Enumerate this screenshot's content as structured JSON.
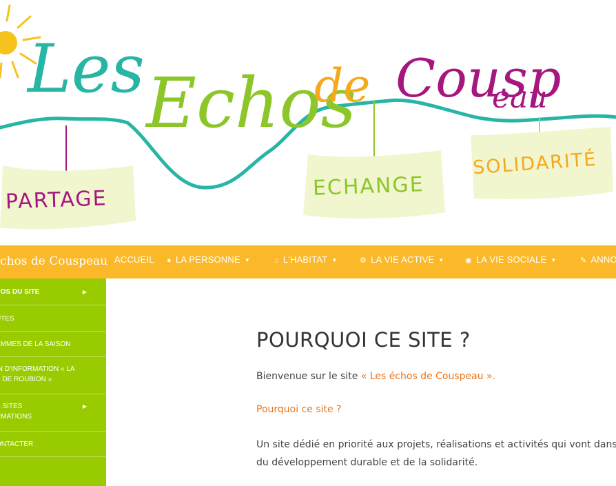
{
  "banner": {
    "title_parts": [
      "Les",
      "Echos",
      "de",
      "Cousp",
      "eau"
    ],
    "signs": [
      "PARTAGE",
      "ECHANGE",
      "SOLIDARITÉ"
    ]
  },
  "navbar": {
    "brand": "échos de Couspeau",
    "items": [
      {
        "label": "ACCUEIL",
        "icon": "",
        "has_caret": false
      },
      {
        "label": "LA PERSONNE",
        "icon": "person-icon",
        "has_caret": true
      },
      {
        "label": "L'HABITAT",
        "icon": "home-icon",
        "has_caret": true
      },
      {
        "label": "LA VIE ACTIVE",
        "icon": "gear-icon",
        "has_caret": true
      },
      {
        "label": "LA VIE SOCIALE",
        "icon": "globe-icon",
        "has_caret": true
      },
      {
        "label": "ANNO",
        "icon": "edit-icon",
        "has_caret": false
      }
    ]
  },
  "sidebar": {
    "items": [
      {
        "lines": [
          "POS DU SITE"
        ],
        "has_arrow": true
      },
      {
        "lines": [
          "UTES"
        ],
        "has_arrow": false
      },
      {
        "lines": [
          "AMMES DE LA SAISON"
        ],
        "has_arrow": false
      },
      {
        "lines": [
          "IN D'INFORMATION « LA",
          "E DE ROUBION »"
        ],
        "has_arrow": false
      },
      {
        "lines": [
          "S SITES",
          "RMATIONS"
        ],
        "has_arrow": true
      },
      {
        "lines": [
          "ONTACTER"
        ],
        "has_arrow": false
      }
    ]
  },
  "main": {
    "title": "POURQUOI CE SITE ?",
    "welcome_prefix": "Bienvenue sur le site ",
    "welcome_link": "« Les échos de Couspeau ».",
    "subheading": "Pourquoi ce site ?",
    "paragraph_line1": "Un site dédié en priorité aux projets, réalisations et activités qui vont dans",
    "paragraph_line2": "du développement durable et de la solidarité."
  },
  "colors": {
    "nav_bg": "#fbb92a",
    "sidebar_bg": "#99cc00",
    "accent_orange": "#e8741c",
    "teal": "#27b5a6",
    "magenta": "#a5167e",
    "lime": "#8cc629"
  }
}
